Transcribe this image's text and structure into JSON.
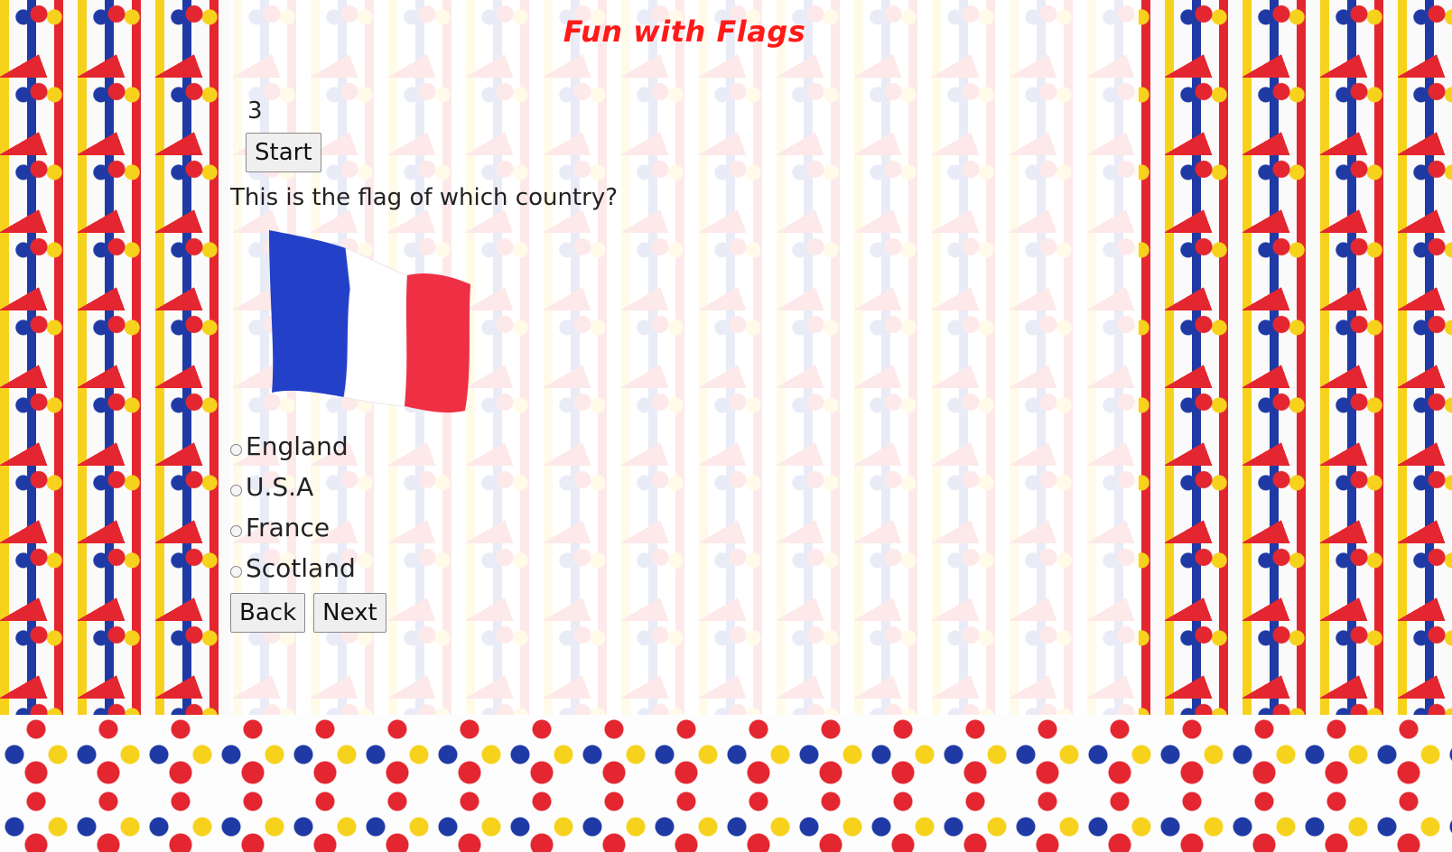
{
  "app": {
    "title": "Fun with Flags"
  },
  "quiz": {
    "counter": "3",
    "start_label": "Start",
    "question": "This is the flag of which country?",
    "flag_colors": [
      "#2340c8",
      "#ffffff",
      "#ef2f44"
    ],
    "options": [
      {
        "label": "England"
      },
      {
        "label": "U.S.A"
      },
      {
        "label": "France"
      },
      {
        "label": "Scotland"
      }
    ],
    "back_label": "Back",
    "next_label": "Next"
  }
}
